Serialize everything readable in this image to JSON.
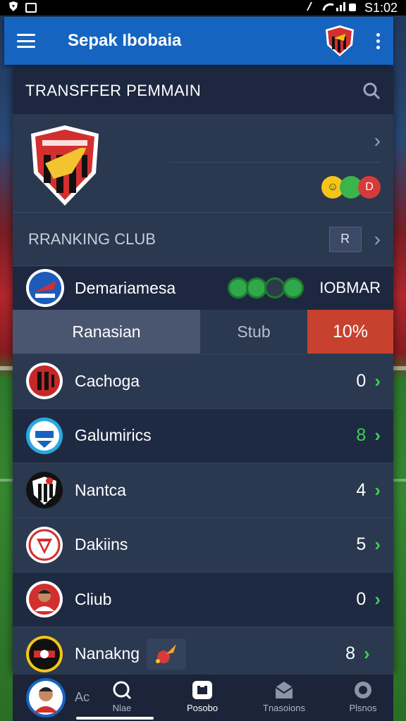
{
  "status_bar": {
    "time": "S1:02"
  },
  "appbar": {
    "title": "Sepak Ibobaia"
  },
  "section": {
    "title": "TRANSFFER PEMMAIN"
  },
  "ranking": {
    "label": "RRANKING CLUB",
    "box_text": "R"
  },
  "team_header": {
    "name": "Demariamesa",
    "code": "IOBMAR"
  },
  "stats": {
    "left": "Ranasian",
    "mid": "Stub",
    "right": "10%"
  },
  "colors": {
    "accent": "#1565c0",
    "highlight": "#c8412f",
    "positive": "#3ad14d"
  },
  "clubs": [
    {
      "name": "Cachoga",
      "score": "0"
    },
    {
      "name": "Galumirics",
      "score": "8",
      "score_color": "#3ad14d"
    },
    {
      "name": "Nantca",
      "score": "4"
    },
    {
      "name": "Dakiins",
      "score": "5"
    },
    {
      "name": "Cliub",
      "score": "0"
    },
    {
      "name": "Nanakng",
      "score": "8"
    }
  ],
  "bottom_nav": {
    "avatar_label": "Ac",
    "items": [
      {
        "label": "Nlae",
        "icon": "search-icon"
      },
      {
        "label": "Posobo",
        "icon": "plus-box-icon"
      },
      {
        "label": "Tnasoions",
        "icon": "inbox-icon"
      },
      {
        "label": "Plsnos",
        "icon": "circle-icon"
      }
    ]
  }
}
